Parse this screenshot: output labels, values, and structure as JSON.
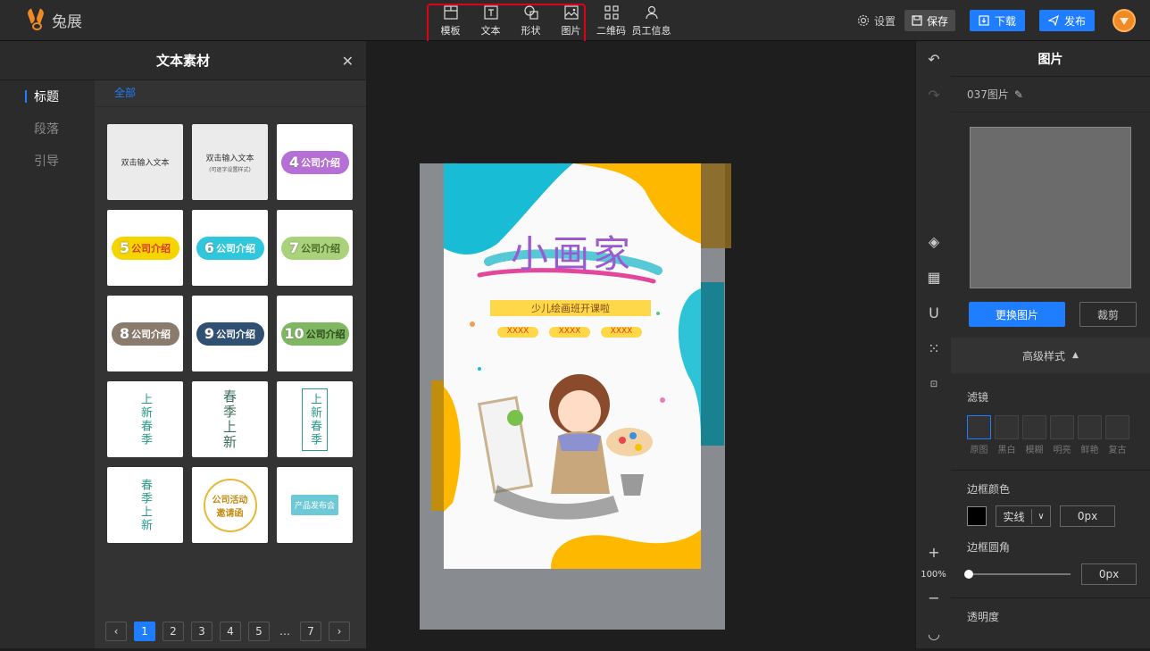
{
  "app": {
    "logo_text": "兔展"
  },
  "toolbar": {
    "tools": [
      {
        "label": "模板",
        "icon": "template-icon"
      },
      {
        "label": "文本",
        "icon": "text-icon"
      },
      {
        "label": "形状",
        "icon": "shape-icon"
      },
      {
        "label": "图片",
        "icon": "image-icon"
      },
      {
        "label": "二维码",
        "icon": "qrcode-icon"
      },
      {
        "label": "员工信息",
        "icon": "user-icon"
      }
    ],
    "settings_label": "设置",
    "save_label": "保存",
    "download_label": "下载",
    "publish_label": "发布"
  },
  "left_panel": {
    "title": "文本素材",
    "categories": [
      "标题",
      "段落",
      "引导"
    ],
    "active_category": "标题",
    "sub_tab": "全部",
    "tiles": [
      {
        "text": "双击输入文本",
        "sub": ""
      },
      {
        "text": "双击输入文本",
        "sub": "(可逐字设置样式)"
      },
      {
        "num": "4",
        "text": "公司介绍",
        "color": "#b56fd6"
      },
      {
        "num": "5",
        "text": "公司介绍",
        "color": "#f5d400"
      },
      {
        "num": "6",
        "text": "公司介绍",
        "color": "#2fc7dd"
      },
      {
        "num": "7",
        "text": "公司介绍",
        "color": "#a9d27a"
      },
      {
        "num": "8",
        "text": "公司介绍",
        "color": "#8b7b6c"
      },
      {
        "num": "9",
        "text": "公司介绍",
        "color": "#2f4f73"
      },
      {
        "num": "10",
        "text": "公司介绍",
        "color": "#7fb861"
      },
      {
        "text": "上新春季"
      },
      {
        "text": "春季上新"
      },
      {
        "text": "上新春季"
      },
      {
        "text": "春季上新"
      },
      {
        "text": "公司活动邀请函"
      },
      {
        "text": "产品发布会"
      }
    ],
    "pages": [
      "1",
      "2",
      "3",
      "4",
      "5",
      "…",
      "7"
    ]
  },
  "poster": {
    "title": "小画家",
    "subtitle": "少儿绘画班开课啦",
    "tags": [
      "XXXX",
      "XXXX",
      "XXXX"
    ]
  },
  "right_tools": {
    "zoom": "100%"
  },
  "properties": {
    "title": "图片",
    "name": "037图片",
    "replace_label": "更换图片",
    "crop_label": "裁剪",
    "advanced_label": "高级样式",
    "filter_label": "滤镜",
    "filters": [
      "原图",
      "黑白",
      "模糊",
      "明亮",
      "鲜艳",
      "复古"
    ],
    "border_color_label": "边框颜色",
    "border_style": "实线",
    "border_width": "0px",
    "border_radius_label": "边框圆角",
    "border_radius": "0px",
    "opacity_label": "透明度"
  }
}
